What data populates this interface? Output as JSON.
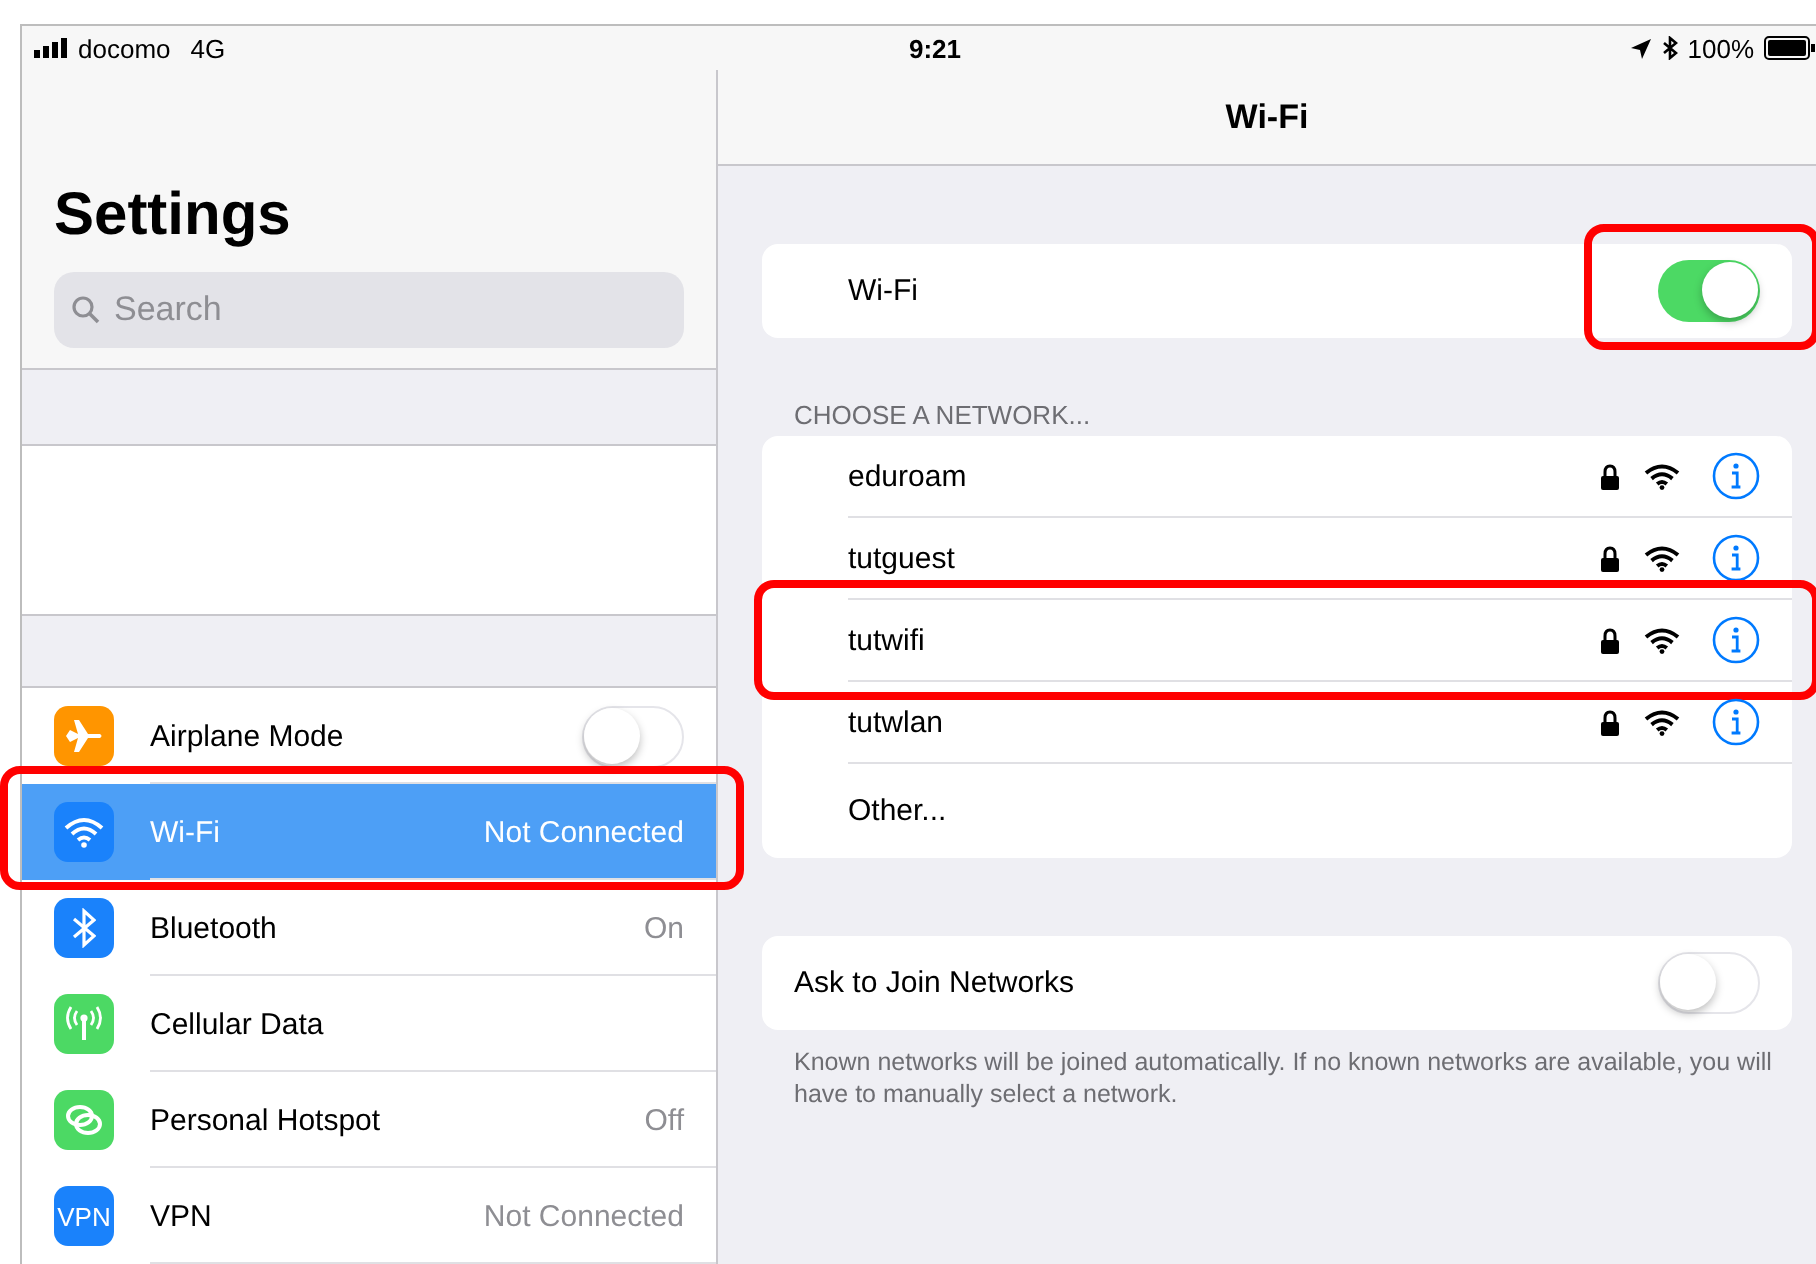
{
  "status_bar": {
    "carrier": "docomo",
    "network": "4G",
    "time": "9:21",
    "battery": "100%"
  },
  "sidebar": {
    "title": "Settings",
    "search": {
      "placeholder": "Search"
    },
    "items": [
      {
        "label": "Airplane Mode",
        "kind": "toggle",
        "on": false,
        "selected": false,
        "color": "#ff9500"
      },
      {
        "label": "Wi-Fi",
        "kind": "value",
        "value": "Not Connected",
        "selected": true,
        "highlighted": true,
        "color": "#1a82fb"
      },
      {
        "label": "Bluetooth",
        "kind": "value",
        "value": "On",
        "selected": false,
        "color": "#1a82fb"
      },
      {
        "label": "Cellular Data",
        "kind": "plain",
        "selected": false,
        "color": "#4cd964"
      },
      {
        "label": "Personal Hotspot",
        "kind": "value",
        "value": "Off",
        "selected": false,
        "color": "#4cd964"
      },
      {
        "label": "VPN",
        "kind": "value",
        "value": "Not Connected",
        "icon_text": "VPN",
        "selected": false,
        "color": "#1a82fb"
      }
    ]
  },
  "detail": {
    "title": "Wi-Fi",
    "wifi": {
      "label": "Wi-Fi",
      "on": true,
      "highlighted": true
    },
    "section_header": "CHOOSE A NETWORK...",
    "networks": [
      {
        "name": "eduroam",
        "kind": "network",
        "locked": true
      },
      {
        "name": "tutguest",
        "kind": "network",
        "locked": true
      },
      {
        "name": "tutwifi",
        "kind": "network",
        "locked": true,
        "highlighted": true
      },
      {
        "name": "tutwlan",
        "kind": "network",
        "locked": true
      },
      {
        "name": "Other...",
        "kind": "other"
      }
    ],
    "ask_to_join": {
      "label": "Ask to Join Networks",
      "on": false
    },
    "footer": "Known networks will be joined automatically. If no known networks are available, you will have to manually select a network."
  }
}
